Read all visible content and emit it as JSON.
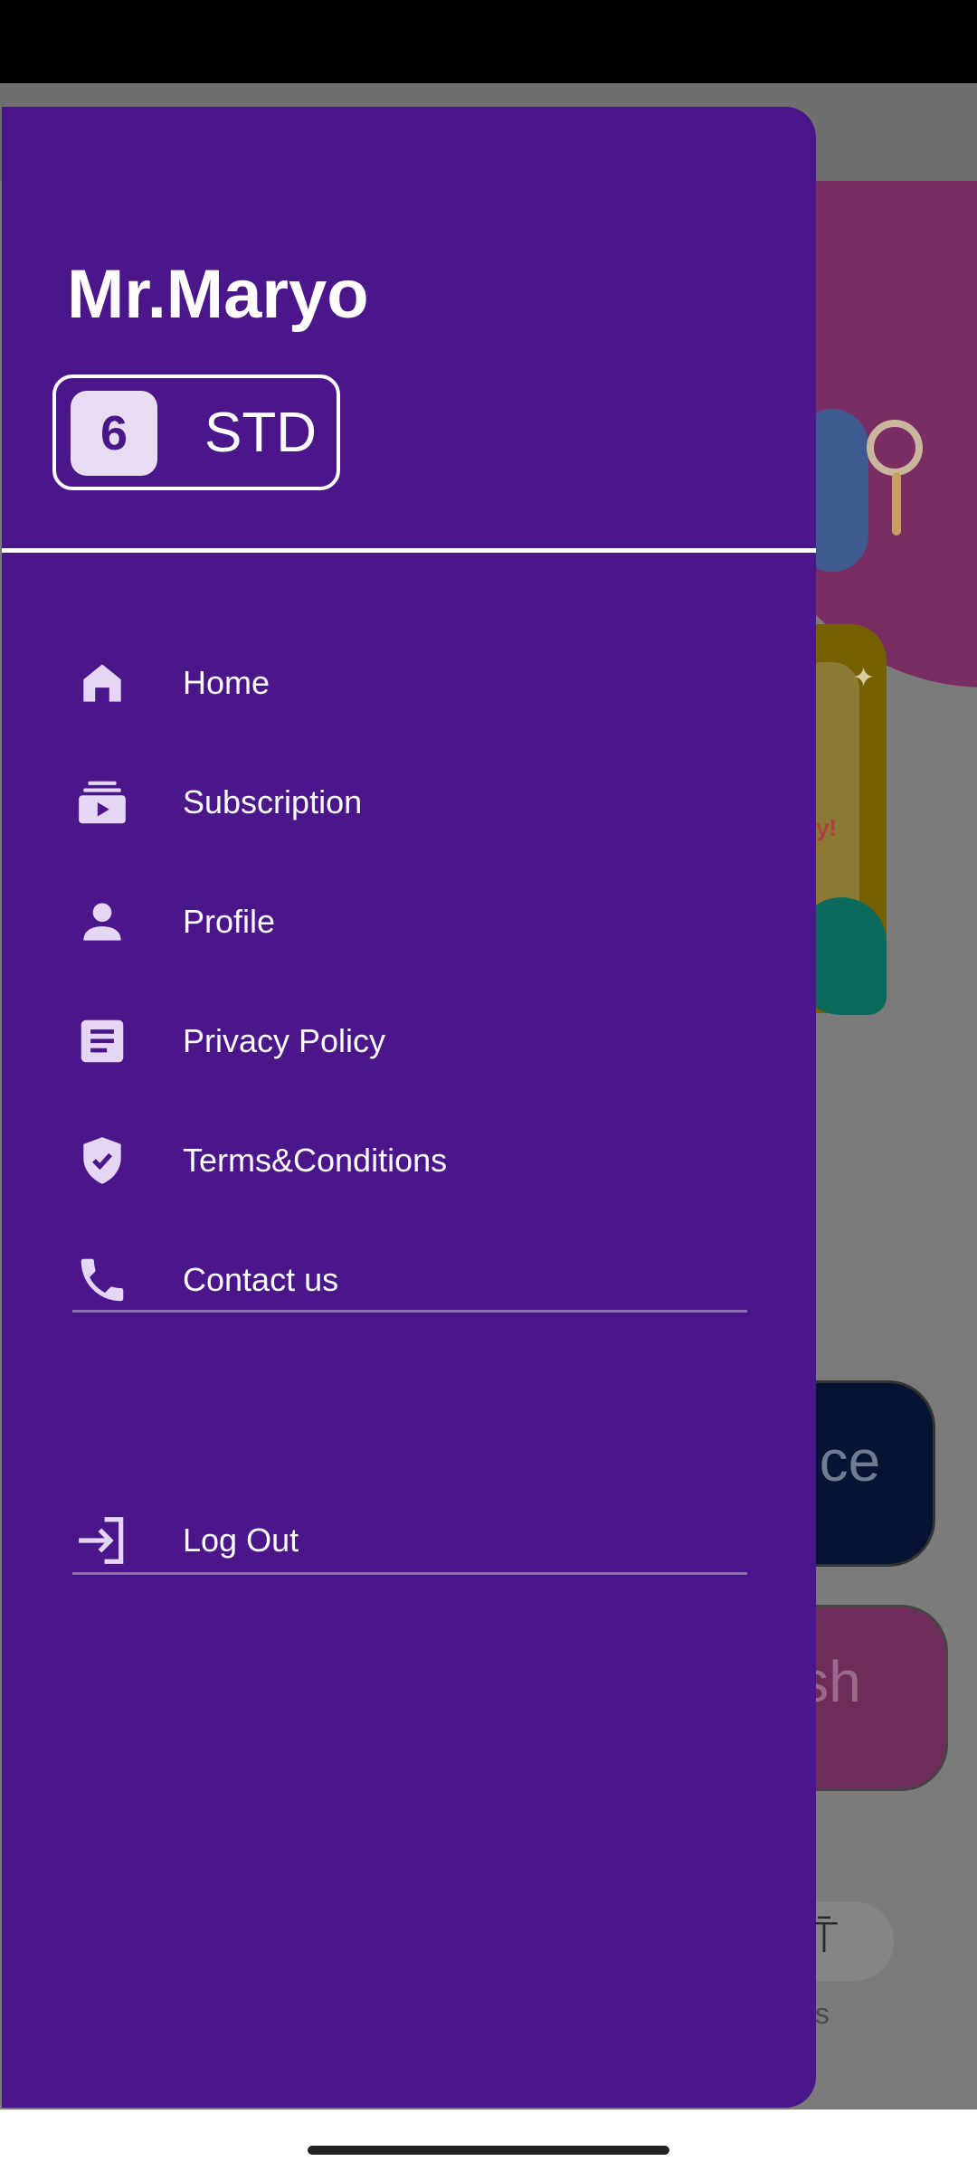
{
  "background": {
    "pill_dark_text": "nce",
    "pill_pink_text": "ish",
    "red_snippet": "y!",
    "bottom_nav_fragment": "sts"
  },
  "drawer": {
    "user_name": "Mr.Maryo",
    "grade_number": "6",
    "grade_label": "STD",
    "menu": [
      {
        "label": "Home",
        "icon": "home-icon"
      },
      {
        "label": "Subscription",
        "icon": "subscriptions-icon"
      },
      {
        "label": "Profile",
        "icon": "person-icon"
      },
      {
        "label": "Privacy Policy",
        "icon": "document-icon"
      },
      {
        "label": "Terms&Conditions",
        "icon": "shield-check-icon"
      },
      {
        "label": "Contact us",
        "icon": "phone-icon"
      }
    ],
    "logout": {
      "label": "Log Out",
      "icon": "login-arrow-icon"
    }
  },
  "colors": {
    "drawer_bg": "#4a1689",
    "icon_tint": "#e6d6f5",
    "scrim": "#7b7b7b"
  }
}
